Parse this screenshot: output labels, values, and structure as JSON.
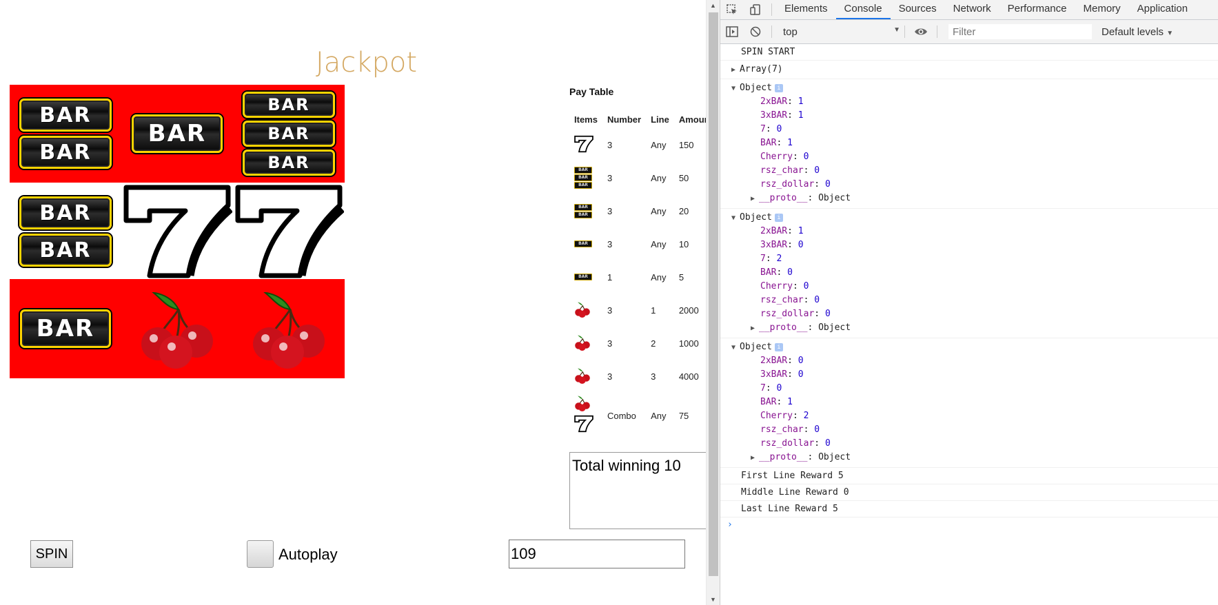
{
  "game": {
    "title": "Jackpot",
    "bar_text": "BAR",
    "paytable_title": "Pay Table",
    "paytable_headers": [
      "Items",
      "Number",
      "Line",
      "Amount"
    ],
    "paytable_rows": [
      {
        "item": "seven",
        "number": "3",
        "line": "Any",
        "amount": "150"
      },
      {
        "item": "3xBAR",
        "number": "3",
        "line": "Any",
        "amount": "50"
      },
      {
        "item": "2xBAR",
        "number": "3",
        "line": "Any",
        "amount": "20"
      },
      {
        "item": "BAR",
        "number": "3",
        "line": "Any",
        "amount": "10"
      },
      {
        "item": "BAR",
        "number": "1",
        "line": "Any",
        "amount": "5"
      },
      {
        "item": "cherry",
        "number": "3",
        "line": "1",
        "amount": "2000"
      },
      {
        "item": "cherry",
        "number": "3",
        "line": "2",
        "amount": "1000"
      },
      {
        "item": "cherry",
        "number": "3",
        "line": "3",
        "amount": "4000"
      },
      {
        "item": "cherry+seven",
        "number": "Combo",
        "line": "Any",
        "amount": "75"
      }
    ],
    "total_winning": "Total winning 10",
    "spin_label": "SPIN",
    "autoplay_label": "Autoplay",
    "autoplay_checked": false,
    "credit_value": "109",
    "reels": {
      "top": [
        "2xBAR",
        "BAR",
        "3xBAR"
      ],
      "middle": [
        "2xBAR",
        "7",
        "7"
      ],
      "bottom": [
        "BAR",
        "Cherry",
        "Cherry"
      ]
    },
    "colors": {
      "reel_red": "#ff0000",
      "title": "#d4a862"
    }
  },
  "devtools": {
    "tabs": [
      "Elements",
      "Console",
      "Sources",
      "Network",
      "Performance",
      "Memory",
      "Application"
    ],
    "active_tab": "Console",
    "context": "top",
    "filter_placeholder": "Filter",
    "levels": "Default levels",
    "icons": [
      "inspect-icon",
      "device-toggle-icon",
      "sidebar-toggle-icon",
      "clear-console-icon",
      "eye-icon"
    ],
    "messages": {
      "spin_start": "SPIN START",
      "array": "Array(7)",
      "object_label": "Object",
      "proto_key": "__proto__",
      "proto_value": "Object",
      "first_line": "First Line Reward 5",
      "middle_line": "Middle Line Reward 0",
      "last_line": "Last Line Reward 5"
    },
    "objects": [
      [
        {
          "k": "2xBAR",
          "v": "1"
        },
        {
          "k": "3xBAR",
          "v": "1"
        },
        {
          "k": "7",
          "v": "0"
        },
        {
          "k": "BAR",
          "v": "1"
        },
        {
          "k": "Cherry",
          "v": "0"
        },
        {
          "k": "rsz_char",
          "v": "0"
        },
        {
          "k": "rsz_dollar",
          "v": "0"
        }
      ],
      [
        {
          "k": "2xBAR",
          "v": "1"
        },
        {
          "k": "3xBAR",
          "v": "0"
        },
        {
          "k": "7",
          "v": "2"
        },
        {
          "k": "BAR",
          "v": "0"
        },
        {
          "k": "Cherry",
          "v": "0"
        },
        {
          "k": "rsz_char",
          "v": "0"
        },
        {
          "k": "rsz_dollar",
          "v": "0"
        }
      ],
      [
        {
          "k": "2xBAR",
          "v": "0"
        },
        {
          "k": "3xBAR",
          "v": "0"
        },
        {
          "k": "7",
          "v": "0"
        },
        {
          "k": "BAR",
          "v": "1"
        },
        {
          "k": "Cherry",
          "v": "2"
        },
        {
          "k": "rsz_char",
          "v": "0"
        },
        {
          "k": "rsz_dollar",
          "v": "0"
        }
      ]
    ]
  }
}
